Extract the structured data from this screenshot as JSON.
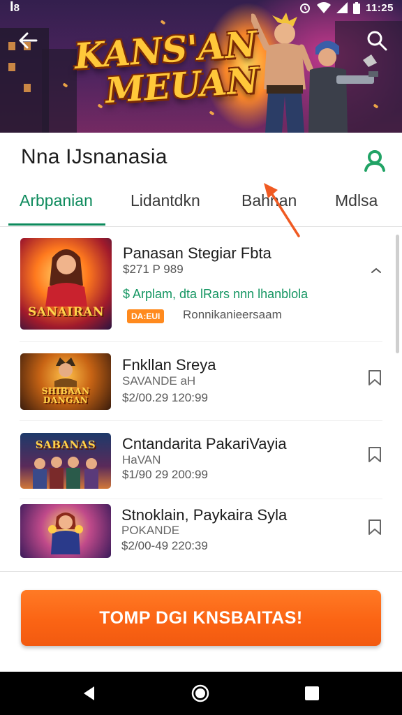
{
  "status_bar": {
    "left_text": "ꟾ8",
    "time": "11:25",
    "icons": [
      "alarm-icon",
      "wifi-icon",
      "signal-icon",
      "battery-icon"
    ]
  },
  "hero": {
    "title_line1": "KANS'AN",
    "title_line2": "MEUAN",
    "back_icon": "back-arrow-icon",
    "search_icon": "search-icon"
  },
  "header": {
    "title": "Nna IJsnanasia",
    "profile_icon": "profile-icon"
  },
  "tabs": [
    {
      "label": "Arbpanian",
      "active": true
    },
    {
      "label": "Lidantdkn",
      "active": false
    },
    {
      "label": "Bahnan",
      "active": false
    },
    {
      "label": "Mdlsa",
      "active": false
    }
  ],
  "items": [
    {
      "thumb_label": "SANAIRAN",
      "title": "Panasan Stegiar Fbta",
      "price": "$271 P 989",
      "highlight": "$ Arplam, dta lRars nnn lhanblola",
      "badge": "DA:EUI",
      "badge_text": "Ronnikanieersaam",
      "action_icon": "chevron-icon"
    },
    {
      "thumb_label": "SHIBAAN DANGAN",
      "title": "Fnkllan Sreya",
      "subtitle": "SAVANDE aH",
      "price": "$2/00.29  120:99",
      "action_icon": "bookmark-icon"
    },
    {
      "thumb_label": "SABANAS",
      "title": "Cntandarita PakariVayia",
      "subtitle": "HaVAN",
      "price": "$1/90 29  200:99",
      "action_icon": "bookmark-icon"
    },
    {
      "thumb_label": "",
      "title": "Stnoklain, Paykaira Syla",
      "subtitle": "POKANDE",
      "price": "$2/00-49  220:39",
      "action_icon": "bookmark-icon"
    }
  ],
  "cta": {
    "label": "TOMP DGI KNSBAITAS!"
  },
  "nav": {
    "back": "nav-back-icon",
    "home": "nav-home-icon",
    "recents": "nav-recents-icon"
  },
  "colors": {
    "accent_green": "#0d8a5c",
    "cta_orange": "#fb6414",
    "badge_orange": "#ff8a1e"
  }
}
